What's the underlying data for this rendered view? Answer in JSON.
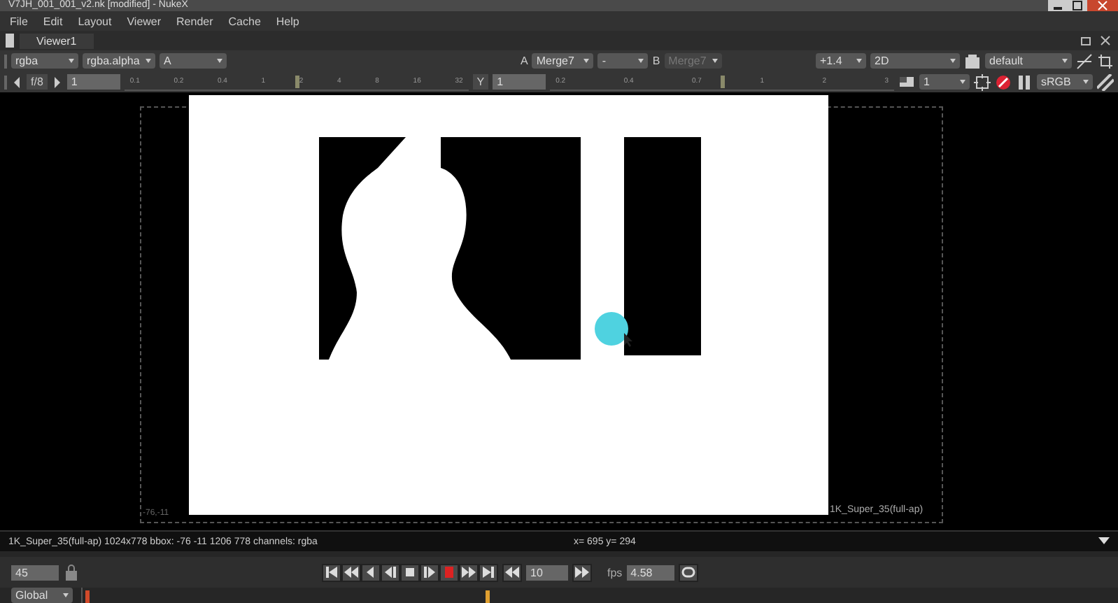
{
  "window": {
    "title": "V7JH_001_001_v2.nk [modified] - NukeX"
  },
  "menu": [
    "File",
    "Edit",
    "Layout",
    "Viewer",
    "Render",
    "Cache",
    "Help"
  ],
  "tabs": [
    {
      "label": "Viewer1",
      "selected": true
    }
  ],
  "toolbar": {
    "layers": "rgba",
    "channel": "rgba.alpha",
    "alpha": "A",
    "input_a_label": "A",
    "input_a": "Merge7",
    "operation": "-",
    "input_b_label": "B",
    "input_b": "Merge7",
    "input_b_disabled": true,
    "gain_readout": "+1.4",
    "view_mode": "2D",
    "lut": "default"
  },
  "controls": {
    "fstop": "f/8",
    "gain": "1",
    "gain_slider": {
      "level": 0.5
    },
    "gain_ticks": [
      "0.1",
      "0.2",
      "0.4",
      "1",
      "2",
      "4",
      "8",
      "16",
      "32"
    ],
    "gamma_label": "Y",
    "gamma": "1",
    "gamma_slider": {
      "level": 0.5
    },
    "gamma_ticks": [
      "0.2",
      "0.4",
      "0.7",
      "1",
      "2",
      "3"
    ],
    "proxy": "1",
    "output_lut": "sRGB"
  },
  "viewer": {
    "format_label": "1K_Super_35(full-ap)",
    "bbox_label": "-76,-11"
  },
  "info": {
    "format": "1K_Super_35(full-ap) 1024x778 bbox: -76 -11 1206 778 channels: rgba",
    "coords": "x= 695 y= 294"
  },
  "playback": {
    "frame": "45",
    "increment": "10",
    "fps_label": "fps",
    "fps": "4.58"
  },
  "timeline": {
    "range": "Global"
  }
}
